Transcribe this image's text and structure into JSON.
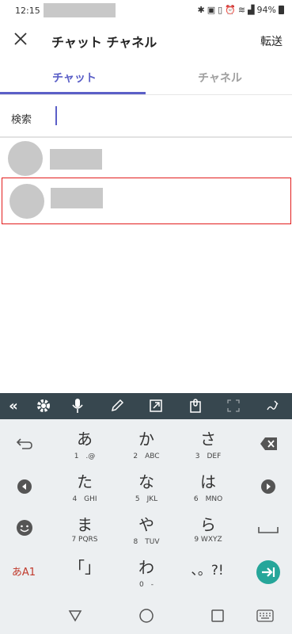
{
  "status": {
    "time": "12:15",
    "battery": "94%"
  },
  "appbar": {
    "title": "チャット チャネル",
    "forward": "転送"
  },
  "tabs": {
    "chat": "チャット",
    "channel": "チャネル"
  },
  "search": {
    "label": "検索"
  },
  "keyboard": {
    "keys": [
      {
        "big": "あ",
        "sub": "1　.@"
      },
      {
        "big": "か",
        "sub": "2　ABC"
      },
      {
        "big": "さ",
        "sub": "3　DEF"
      },
      {
        "big": "た",
        "sub": "4　GHI"
      },
      {
        "big": "な",
        "sub": "5　JKL"
      },
      {
        "big": "は",
        "sub": "6　MNO"
      },
      {
        "big": "ま",
        "sub": "7 PQRS"
      },
      {
        "big": "や",
        "sub": "8　TUV"
      },
      {
        "big": "ら",
        "sub": "9 WXYZ"
      },
      {
        "big": "「」",
        "sub": ""
      },
      {
        "big": "わ",
        "sub": "0　-"
      },
      {
        "big": "、。?!",
        "sub": ""
      }
    ],
    "mode_label": "あA1",
    "accent": "#26a69a"
  },
  "colors": {
    "brand": "#5b5fc7",
    "selection": "#e21d1d"
  }
}
